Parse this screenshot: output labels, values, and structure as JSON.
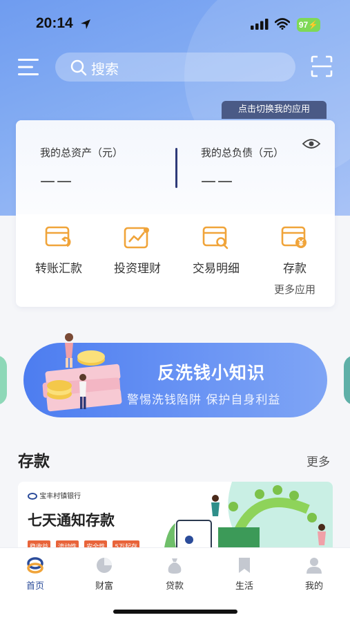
{
  "status_bar": {
    "time": "20:14",
    "battery": "97"
  },
  "search": {
    "placeholder": "搜索"
  },
  "switch_tip": "点击切换我的应用",
  "assets": {
    "total_assets_label": "我的总资产（元）",
    "total_assets_value": "——",
    "total_debt_label": "我的总负债（元）",
    "total_debt_value": "——"
  },
  "quick_actions": [
    {
      "label": "转账汇款",
      "icon": "transfer-card-icon"
    },
    {
      "label": "投资理财",
      "icon": "investment-chart-icon"
    },
    {
      "label": "交易明细",
      "icon": "transaction-search-icon"
    },
    {
      "label": "存款",
      "icon": "deposit-yuan-icon"
    }
  ],
  "more_apps": "更多应用",
  "banner": {
    "title": "反洗钱小知识",
    "subtitle": "警惕洗钱陷阱 保护自身利益"
  },
  "deposit_section": {
    "title": "存款",
    "more": "更多",
    "promo": {
      "bank_name": "宝丰村镇银行",
      "title": "七天通知存款",
      "tags": [
        "稳收益",
        "流动性",
        "安全性",
        "5万起存"
      ]
    }
  },
  "tabbar": [
    {
      "label": "首页",
      "icon": "home-logo-icon",
      "active": true
    },
    {
      "label": "财富",
      "icon": "wealth-pie-icon",
      "active": false
    },
    {
      "label": "贷款",
      "icon": "loan-bag-icon",
      "active": false
    },
    {
      "label": "生活",
      "icon": "life-bookmark-icon",
      "active": false
    },
    {
      "label": "我的",
      "icon": "profile-person-icon",
      "active": false
    }
  ],
  "colors": {
    "accent": "#4d7df0",
    "icon_orange": "#f0a43a",
    "active_tab": "#2b4c9a"
  }
}
